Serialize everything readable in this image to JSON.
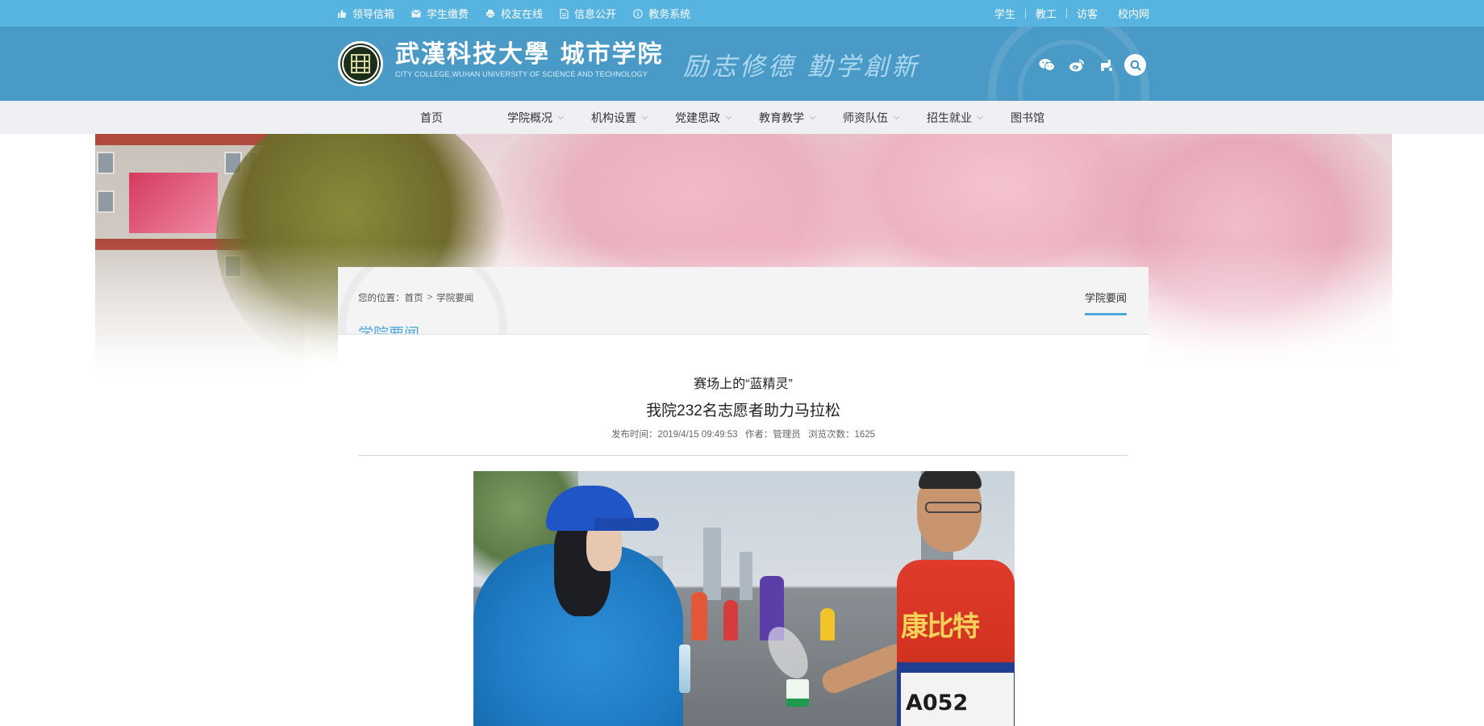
{
  "topbar": {
    "links": [
      {
        "label": "领导信箱",
        "icon": "thumbs-up-icon"
      },
      {
        "label": "学生缴费",
        "icon": "envelope-icon"
      },
      {
        "label": "校友在线",
        "icon": "printer-icon"
      },
      {
        "label": "信息公开",
        "icon": "document-icon"
      },
      {
        "label": "教务系统",
        "icon": "info-circle-icon"
      }
    ],
    "audiences": [
      "学生",
      "教工",
      "访客",
      "校内网"
    ]
  },
  "header": {
    "school_name": "武漢科技大學 城市学院",
    "school_name_en": "CITY COLLEGE,WUHAN UNIVERSITY OF SCIENCE AND TECHNOLOGY",
    "motto": "励志修德 勤学創新",
    "social_icons": [
      "wechat-icon",
      "weibo-icon",
      "scooter-icon",
      "search-icon"
    ]
  },
  "nav": {
    "items": [
      {
        "label": "首页",
        "has_dropdown": false
      },
      {
        "label": "学院概况",
        "has_dropdown": true
      },
      {
        "label": "机构设置",
        "has_dropdown": true
      },
      {
        "label": "党建思政",
        "has_dropdown": true
      },
      {
        "label": "教育教学",
        "has_dropdown": true
      },
      {
        "label": "师资队伍",
        "has_dropdown": true
      },
      {
        "label": "招生就业",
        "has_dropdown": true
      },
      {
        "label": "图书馆",
        "has_dropdown": false
      }
    ]
  },
  "content": {
    "breadcrumb": {
      "prefix": "您的位置：",
      "home": "首页",
      "separator": ">",
      "current": "学院要闻"
    },
    "side_tab": "学院要闻",
    "section_title": "学院要闻",
    "article": {
      "subtitle": "赛场上的“蓝精灵”",
      "title": "我院232名志愿者助力马拉松",
      "meta": {
        "published_label": "发布时间：",
        "published": "2019/4/15 09:49:53",
        "author_label": "作者：",
        "author": "管理员",
        "views_label": "浏览次数：",
        "views": "1625"
      }
    },
    "photo": {
      "vest_text": "康比特",
      "bib_text": "A052"
    }
  },
  "colors": {
    "topbar": "#57b3e0",
    "header": "#4a9ac7",
    "nav_bg": "#eff0f4",
    "accent": "#4ea8dc"
  }
}
